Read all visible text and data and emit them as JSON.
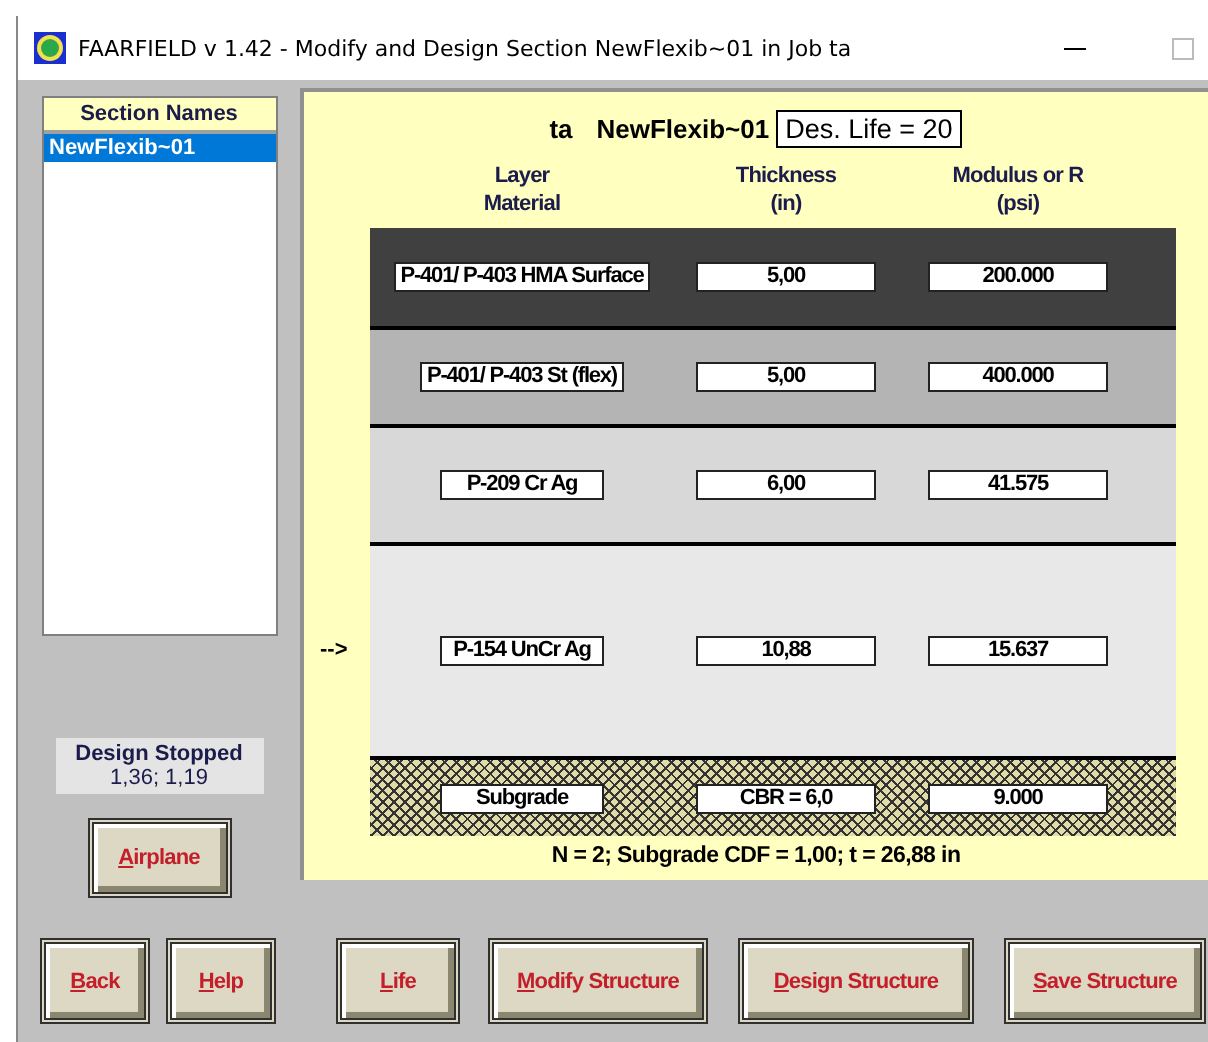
{
  "window": {
    "title": "FAARFIELD v 1.42 - Modify and Design Section NewFlexib~01 in Job ta"
  },
  "section_names": {
    "header": "Section Names",
    "items": [
      {
        "label": "NewFlexib~01",
        "selected": true
      }
    ]
  },
  "design_status": {
    "title": "Design Stopped",
    "values": "1,36;  1,19"
  },
  "airplane_button": "Airplane",
  "structure": {
    "job": "ta",
    "section": "NewFlexib~01",
    "design_life": "Des. Life = 20",
    "columns": [
      {
        "label": "Layer",
        "unit": "Material"
      },
      {
        "label": "Thickness",
        "unit": "(in)"
      },
      {
        "label": "Modulus or R",
        "unit": "(psi)"
      }
    ],
    "pointer": "-->",
    "layers": [
      {
        "kind": "layer",
        "material": "P-401/ P-403 HMA Surface",
        "thickness": "5,00",
        "modulus": "200.000",
        "color": "#404040",
        "current": false
      },
      {
        "kind": "layer",
        "material": "P-401/ P-403 St (flex)",
        "thickness": "5,00",
        "modulus": "400.000",
        "color": "#b4b4b4",
        "current": false
      },
      {
        "kind": "layer",
        "material": "P-209 Cr Ag",
        "thickness": "6,00",
        "modulus": "41.575",
        "color": "#d8d8d8",
        "current": false
      },
      {
        "kind": "layer",
        "material": "P-154 UnCr Ag",
        "thickness": "10,88",
        "modulus": "15.637",
        "color": "#e8e8e8",
        "current": true
      },
      {
        "kind": "subgrade",
        "material": "Subgrade",
        "thickness": "CBR = 6,0",
        "modulus": "9.000",
        "current": false
      }
    ],
    "summary": "N = 2;  Subgrade CDF = 1,00;  t = 26,88 in"
  },
  "buttons": [
    "Back",
    "Help",
    "Life",
    "Modify Structure",
    "Design Structure",
    "Save Structure"
  ]
}
